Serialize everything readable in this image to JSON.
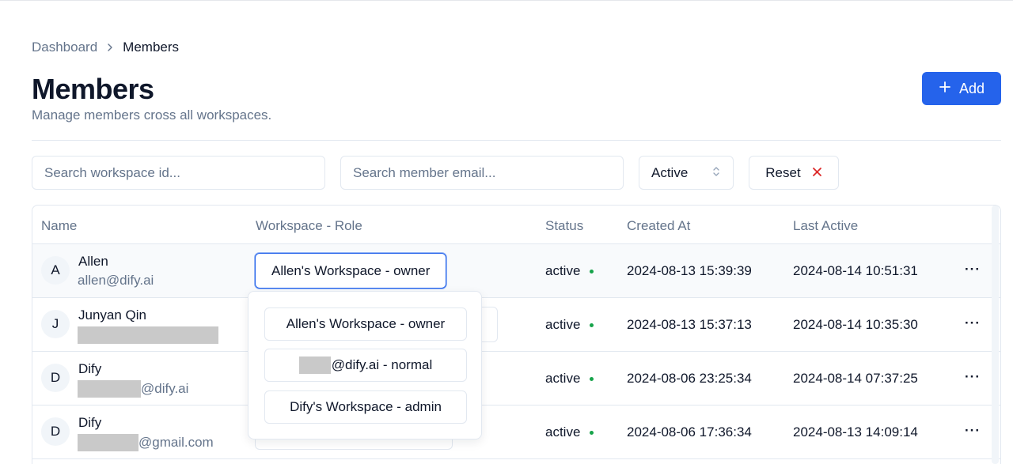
{
  "breadcrumb": {
    "parent": "Dashboard",
    "current": "Members"
  },
  "header": {
    "title": "Members",
    "subtitle": "Manage members cross all workspaces.",
    "add_label": "Add"
  },
  "filters": {
    "workspace_placeholder": "Search workspace id...",
    "email_placeholder": "Search member email...",
    "status_value": "Active",
    "reset_label": "Reset"
  },
  "table": {
    "columns": [
      "Name",
      "Workspace - Role",
      "Status",
      "Created At",
      "Last Active"
    ],
    "rows": [
      {
        "initial": "A",
        "name": "Allen",
        "email": "allen@dify.ai",
        "workspace_role": "Allen's Workspace - owner",
        "status": "active",
        "created_at": "2024-08-13 15:39:39",
        "last_active": "2024-08-14 10:51:31"
      },
      {
        "initial": "J",
        "name": "Junyan Qin",
        "email": "",
        "workspace_role": "",
        "status": "active",
        "created_at": "2024-08-13 15:37:13",
        "last_active": "2024-08-14 10:35:30"
      },
      {
        "initial": "D",
        "name": "Dify",
        "email": "@dify.ai",
        "workspace_role": "",
        "status": "active",
        "created_at": "2024-08-06 23:25:34",
        "last_active": "2024-08-14 07:37:25"
      },
      {
        "initial": "D",
        "name": "Dify",
        "email": "@gmail.com",
        "workspace_role": "",
        "status": "active",
        "created_at": "2024-08-06 17:36:34",
        "last_active": "2024-08-13 14:09:14"
      }
    ],
    "more_label": "···"
  },
  "dropdown": {
    "items": [
      "Allen's Workspace - owner",
      "@dify.ai - normal",
      "Dify's Workspace - admin"
    ]
  },
  "colors": {
    "accent": "#2563eb",
    "status_active": "#16a34a",
    "reset_icon": "#dc2626"
  },
  "icons": {
    "breadcrumb_separator": "chevron-right-icon",
    "add": "plus-icon",
    "select": "chevron-up-down-icon",
    "reset": "x-icon",
    "more": "ellipsis-icon"
  }
}
